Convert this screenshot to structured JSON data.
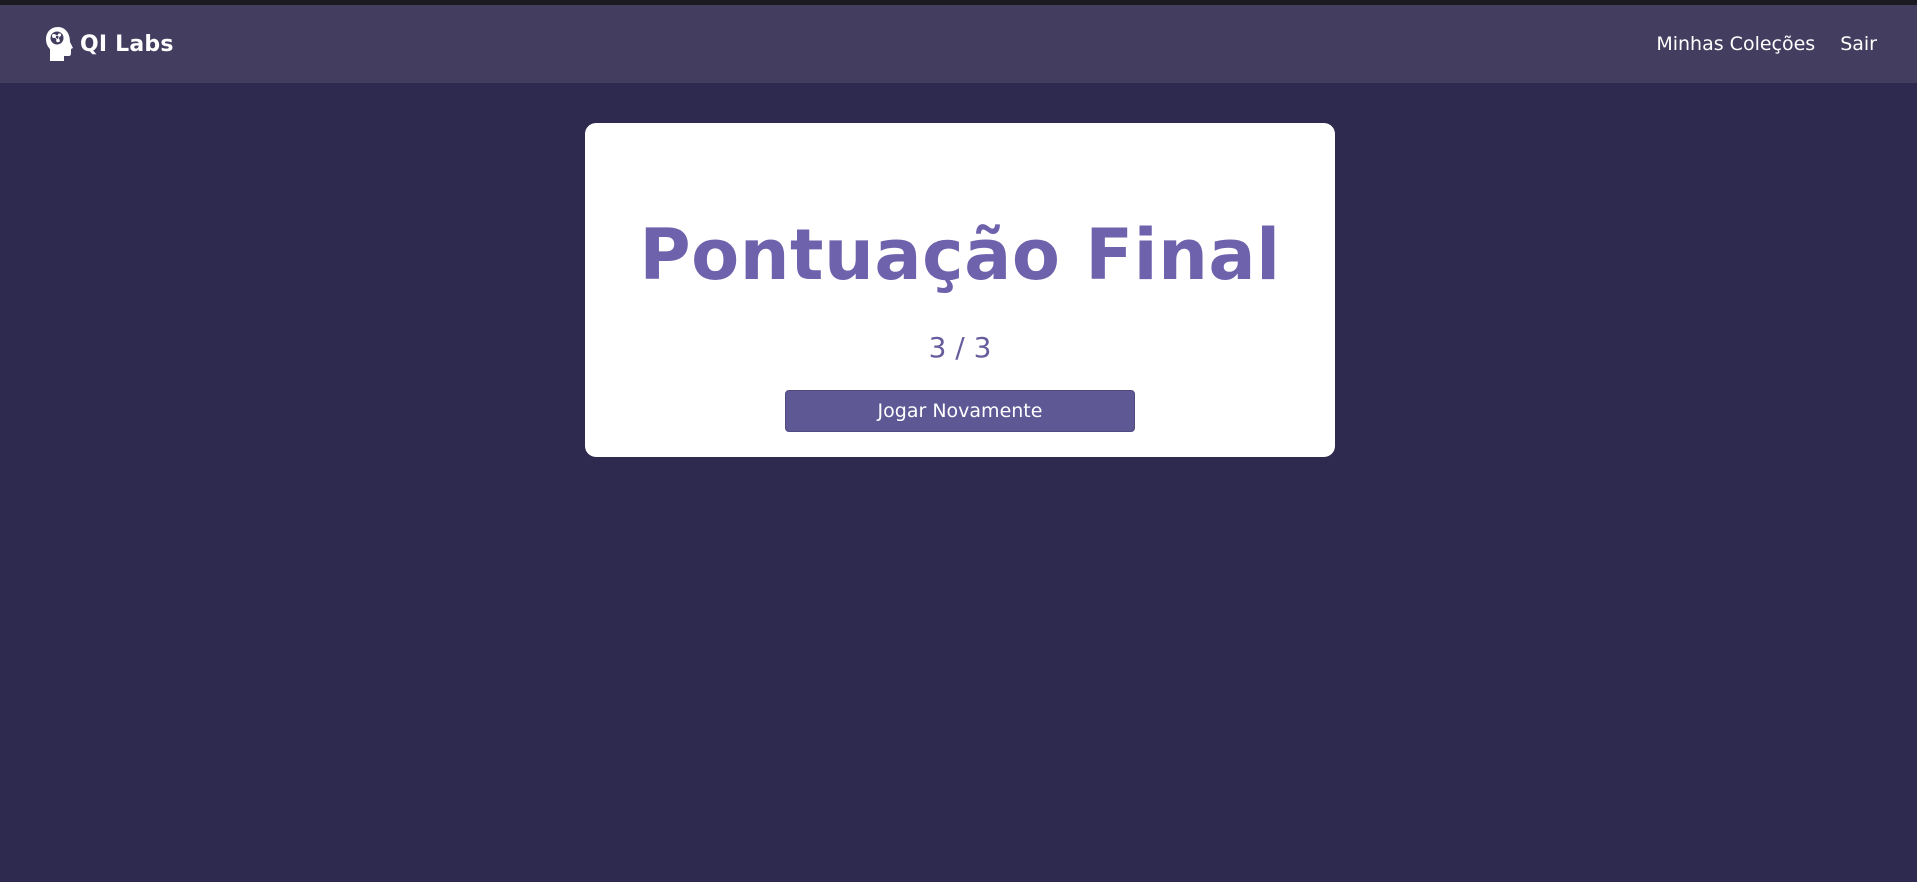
{
  "app": {
    "brand_name": "QI Labs",
    "brand_icon": "head-brain-icon"
  },
  "nav": {
    "items": [
      {
        "label": "Minhas Coleções"
      },
      {
        "label": "Sair"
      }
    ]
  },
  "result": {
    "title": "Pontuação Final",
    "score": "3 / 3",
    "play_again_label": "Jogar Novamente"
  },
  "colors": {
    "background": "#2e294e",
    "navbar": "#433e60",
    "card": "#ffffff",
    "title": "#6f62ad",
    "button": "#5e5895"
  }
}
